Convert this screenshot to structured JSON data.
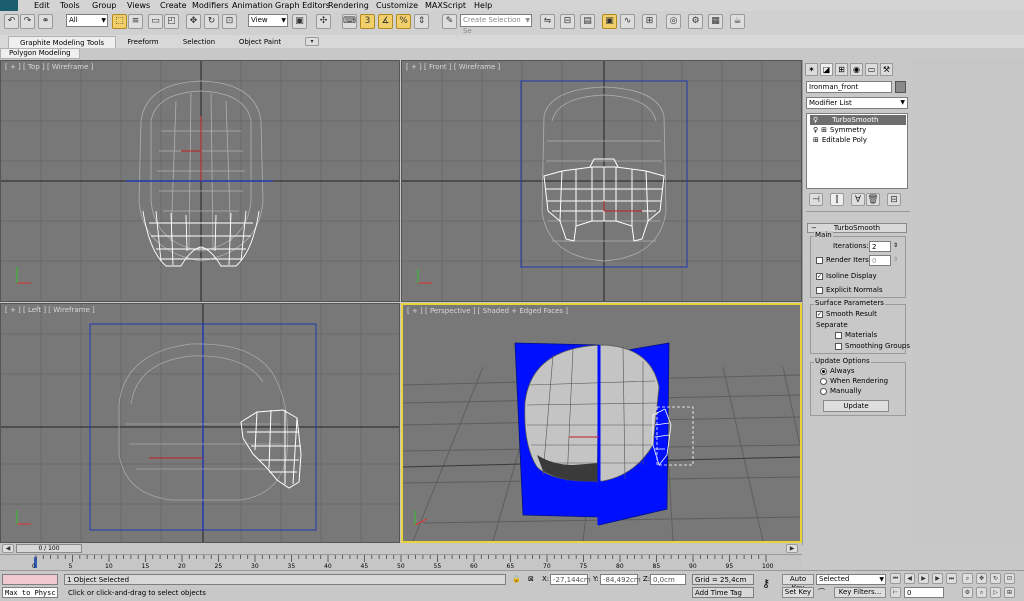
{
  "menu": {
    "items": [
      "Edit",
      "Tools",
      "Group",
      "Views",
      "Create",
      "Modifiers",
      "Animation",
      "Graph Editors",
      "Rendering",
      "Customize",
      "MAXScript",
      "Help"
    ]
  },
  "toolbar": {
    "filter_value": "All",
    "view_value": "View",
    "selection_set_placeholder": "Create Selection Se",
    "icons": [
      "undo-icon",
      "redo-icon",
      "link-icon",
      "unlink-icon",
      "bind-icon",
      "select-object-icon",
      "select-by-name-icon",
      "rect-selection-icon",
      "window-crossing-icon",
      "move-icon",
      "rotate-icon",
      "scale-icon",
      "pivot-icon",
      "snap-icon",
      "angle-snap-icon",
      "percent-snap-icon",
      "spinner-snap-icon",
      "edit-named-sets-icon",
      "mirror-icon",
      "align-icon",
      "layers-icon",
      "graphite-icon",
      "curve-editor-icon",
      "schematic-icon",
      "material-editor-icon",
      "render-setup-icon",
      "rendered-frame-icon",
      "render-icon"
    ]
  },
  "ribbon": {
    "tabs": [
      "Graphite Modeling Tools",
      "Freeform",
      "Selection",
      "Object Paint"
    ],
    "panel": "Polygon Modeling"
  },
  "viewports": {
    "top": {
      "label": "[ + ] [ Top ] [ Wireframe ]"
    },
    "front": {
      "label": "[ + ] [ Front ] [ Wireframe ]"
    },
    "left": {
      "label": "[ + ] [ Left ] [ Wireframe ]"
    },
    "perspective": {
      "label": "[ + ] [ Perspective ] [ Shaded + Edged Faces ]"
    }
  },
  "command_panel": {
    "object_name": "Ironman_front",
    "modifier_list": "Modifier List",
    "stack": [
      "TurboSmooth",
      "Symmetry",
      "Editable Poly"
    ],
    "rollout_title": "TurboSmooth",
    "main": {
      "label": "Main",
      "iterations_label": "Iterations:",
      "iterations_value": "2",
      "render_iters_label": "Render Iters:",
      "render_iters_value": "0",
      "isoline_label": "Isoline Display",
      "explicit_label": "Explicit Normals"
    },
    "surface": {
      "label": "Surface Parameters",
      "smooth_label": "Smooth Result",
      "separate_label": "Separate",
      "materials_label": "Materials",
      "smoothing_groups_label": "Smoothing Groups"
    },
    "update": {
      "label": "Update Options",
      "always": "Always",
      "when_rendering": "When Rendering",
      "manually": "Manually",
      "update_button": "Update"
    }
  },
  "timeline": {
    "frame": "0 / 100",
    "ticks": [
      "0",
      "5",
      "10",
      "15",
      "20",
      "25",
      "30",
      "35",
      "40",
      "45",
      "50",
      "55",
      "60",
      "65",
      "70",
      "75",
      "80",
      "85",
      "90",
      "95",
      "100"
    ]
  },
  "status": {
    "maxscript": "Max to Physc",
    "selected": "1 Object Selected",
    "prompt": "Click or click-and-drag to select objects",
    "x_label": "X:",
    "x_value": "-27,144cm",
    "y_label": "Y:",
    "y_value": "-84,492cm",
    "z_label": "Z:",
    "z_value": "0,0cm",
    "grid": "Grid = 25,4cm",
    "add_time_tag": "Add Time Tag",
    "auto_key": "Auto Key",
    "set_key": "Set Key",
    "key_mode": "Selected",
    "key_filters": "Key Filters...",
    "frame_value": "0"
  },
  "colors": {
    "active_viewport": "#e8d43a",
    "viewport_bg": "#787878",
    "accent": "#f1cf6a",
    "blue_plane": "#0010ff"
  }
}
